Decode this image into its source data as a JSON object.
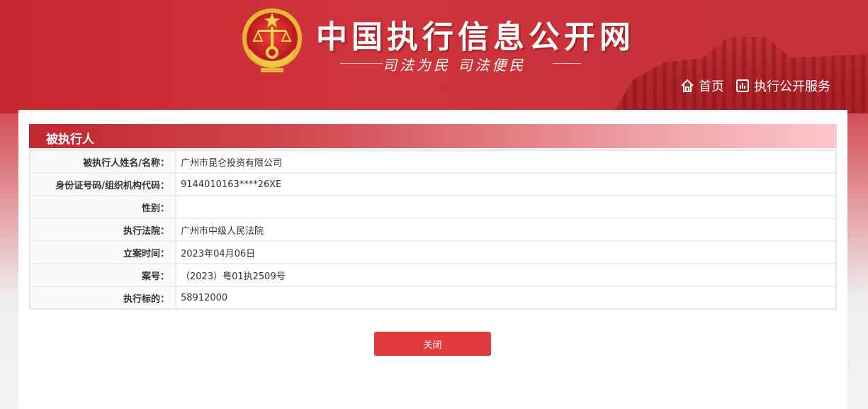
{
  "header": {
    "site_title": "中国执行信息公开网",
    "slogan": "司法为民   司法便民",
    "nav": [
      {
        "label": "首页",
        "icon": "home-icon"
      },
      {
        "label": "执行公开服务",
        "icon": "chart-icon"
      }
    ]
  },
  "section": {
    "title": "被执行人"
  },
  "details": [
    {
      "label": "被执行人姓名/名称：",
      "value": "广州市昆仑投资有限公司"
    },
    {
      "label": "身份证号码/组织机构代码：",
      "value": "9144010163****26XE"
    },
    {
      "label": "性别：",
      "value": ""
    },
    {
      "label": "执行法院：",
      "value": "广州市中级人民法院"
    },
    {
      "label": "立案时间：",
      "value": "2023年04月06日"
    },
    {
      "label": "案号：",
      "value": "（2023）粤01执2509号"
    },
    {
      "label": "执行标的：",
      "value": "58912000"
    }
  ],
  "close_button": "关闭",
  "colors": {
    "brand_red": "#c8262f",
    "button_red": "#e03a3f"
  }
}
